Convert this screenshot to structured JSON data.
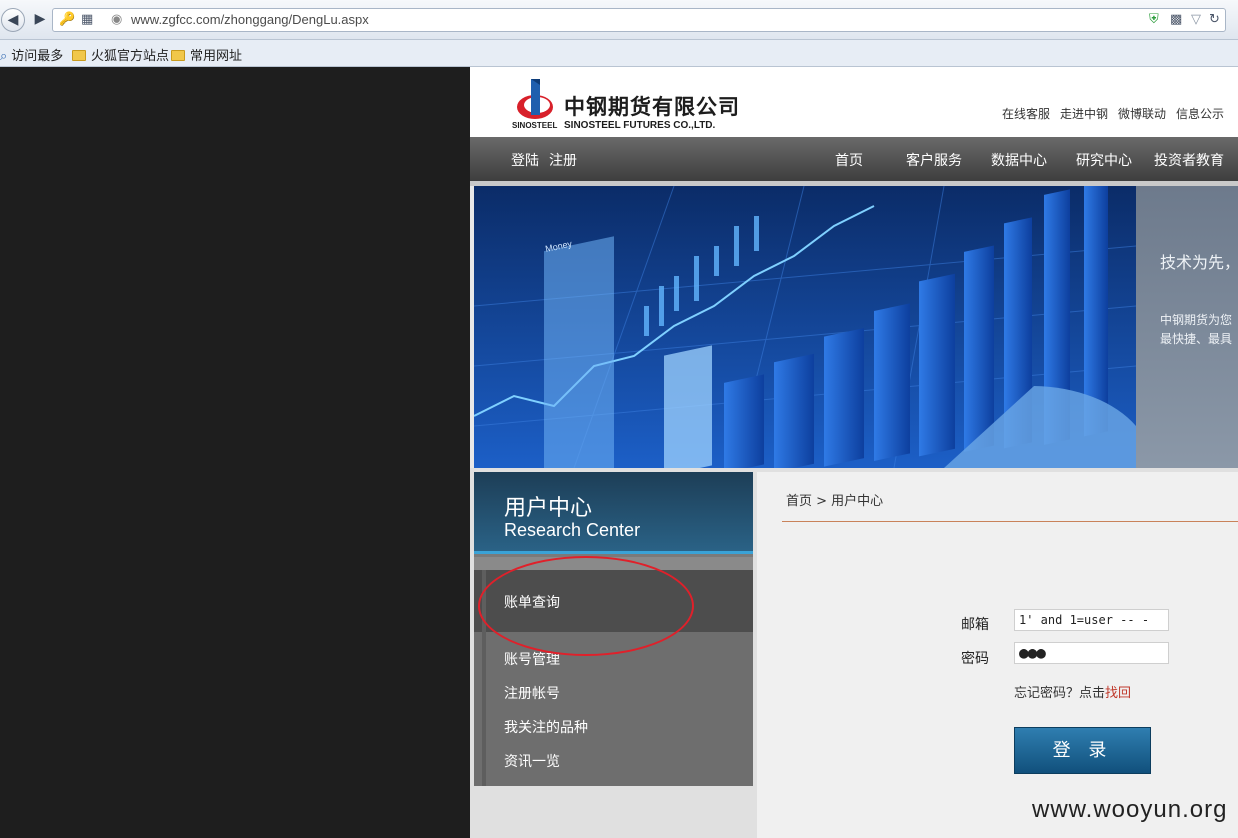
{
  "browser": {
    "url": "www.zgfcc.com/zhonggang/DengLu.aspx",
    "bookmarks": [
      "访问最多",
      "火狐官方站点",
      "常用网址"
    ]
  },
  "header": {
    "logo_cn": "中钢期货有限公司",
    "logo_en": "SINOSTEEL FUTURES CO.,LTD.",
    "logo_mark_text": "SINOSTEEL",
    "top_links": [
      "在线客服",
      "走进中钢",
      "微博联动",
      "信息公示"
    ]
  },
  "navbar": {
    "login": "登陆",
    "register": "注册",
    "items": [
      "首页",
      "客户服务",
      "数据中心",
      "研究中心",
      "投资者教育"
    ]
  },
  "banner": {
    "money_label": "Money",
    "slogan": "技术为先，",
    "desc_line1": "中钢期货为您",
    "desc_line2": "最快捷、最具"
  },
  "sidebar": {
    "title": "用户中心",
    "subtitle": "Research Center",
    "active_item": "账单查询",
    "items": [
      "账号管理",
      "注册帐号",
      "我关注的品种",
      "资讯一览"
    ]
  },
  "content": {
    "breadcrumb": "首页 > 用户中心",
    "email_label": "邮箱",
    "email_value": "1' and 1=user -- -",
    "password_label": "密码",
    "password_value": "●●●",
    "forgot_text": "忘记密码？点击",
    "forgot_link": "找回",
    "login_button": "登 录"
  },
  "watermark": "www.wooyun.org"
}
